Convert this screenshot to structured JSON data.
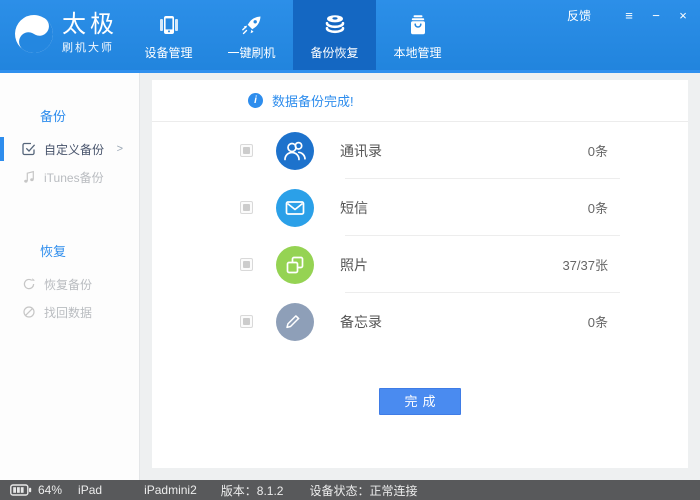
{
  "header": {
    "logo": {
      "title": "太极",
      "subtitle": "刷机大师"
    },
    "tabs": [
      {
        "label": "设备管理",
        "icon": "device-manage-icon",
        "active": false
      },
      {
        "label": "一键刷机",
        "icon": "one-key-flash-icon",
        "active": false
      },
      {
        "label": "备份恢复",
        "icon": "backup-restore-icon",
        "active": true
      },
      {
        "label": "本地管理",
        "icon": "local-manage-icon",
        "active": false
      }
    ],
    "feedback_label": "反馈",
    "window_buttons": {
      "menu": "≡",
      "minimize": "−",
      "close": "×"
    }
  },
  "sidebar": {
    "sections": [
      {
        "title": "备份",
        "items": [
          {
            "label": "自定义备份",
            "icon": "custom-backup-icon",
            "active": true,
            "arrow": ">"
          },
          {
            "label": "iTunes备份",
            "icon": "itunes-backup-icon",
            "active": false
          }
        ]
      },
      {
        "title": "恢复",
        "items": [
          {
            "label": "恢复备份",
            "icon": "restore-backup-icon",
            "active": false
          },
          {
            "label": "找回数据",
            "icon": "recover-data-icon",
            "active": false
          }
        ]
      }
    ]
  },
  "main": {
    "banner": {
      "text": "数据备份完成!",
      "icon": "info-icon"
    },
    "rows": [
      {
        "label": "通讯录",
        "count": "0条",
        "icon": "contacts-icon",
        "color": "#1d72cc"
      },
      {
        "label": "短信",
        "count": "0条",
        "icon": "sms-icon",
        "color": "#2ba0e8"
      },
      {
        "label": "照片",
        "count": "37/37张",
        "icon": "photos-icon",
        "color": "#95d353"
      },
      {
        "label": "备忘录",
        "count": "0条",
        "icon": "memo-icon",
        "color": "#8e9fb8"
      }
    ],
    "done_button": "完成"
  },
  "statusbar": {
    "battery_percent": "64%",
    "device_type": "iPad",
    "device_name": "iPadmini2",
    "version": "版本：8.1.2",
    "device_status": "设备状态：正常连接"
  },
  "colors": {
    "header_blue": "#2487e0",
    "active_tab_blue": "#1467c2",
    "accent_blue": "#2e8ded",
    "contacts_blue": "#1d72cc",
    "sms_blue": "#2ba0e8",
    "photos_green": "#95d353",
    "memo_gray": "#8e9fb8",
    "button_blue": "#4a8bf0",
    "statusbar_gray": "#58595b"
  }
}
